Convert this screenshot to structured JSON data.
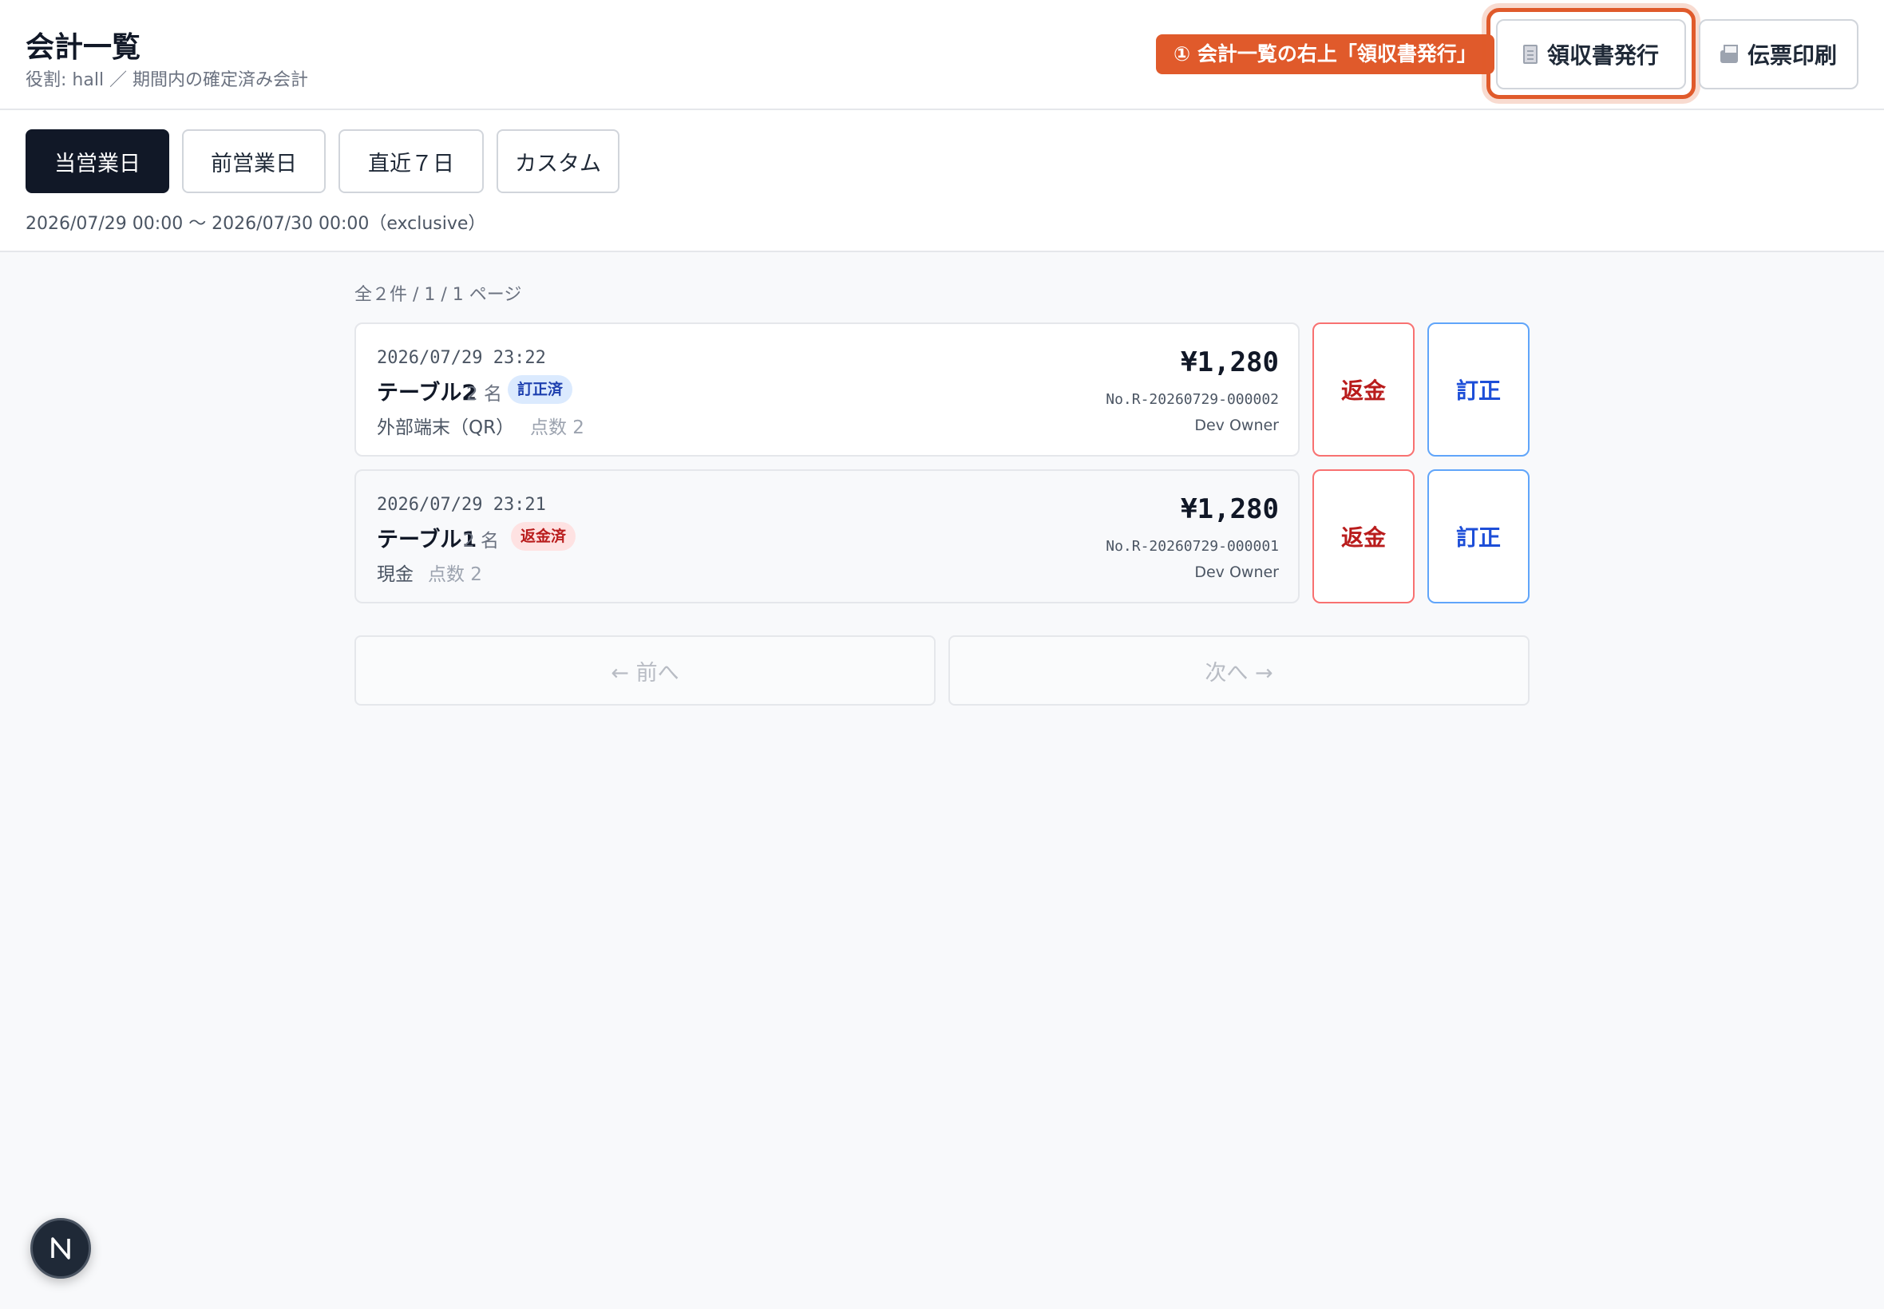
{
  "header": {
    "title": "会計一覧",
    "subtitle": "役割: hall ／ 期間内の確定済み会計",
    "callout": "① 会計一覧の右上「領収書発行」",
    "receipt_button": "領収書発行",
    "print_button": "伝票印刷",
    "receipt_icon": "receipt-icon",
    "print_icon": "printer-icon",
    "accent_color": "#e05a2b"
  },
  "filters": {
    "buttons": [
      "当営業日",
      "前営業日",
      "直近７日",
      "カスタム"
    ],
    "active": "当営業日",
    "range_text": "2026/07/29 00:00 〜 2026/07/30 00:00（exclusive）"
  },
  "list": {
    "count_text": "全２件 / 1 / 1 ページ",
    "rows": [
      {
        "datetime": "2026/07/29 23:22",
        "table": "テーブル2",
        "guests": "2 名",
        "badge": "訂正済",
        "payment": "外部端末（QR）",
        "points": "点数 2",
        "amount": "¥1,280",
        "receipt_no": "No.R-20260729-000002",
        "staff": "Dev Owner",
        "refund_label": "返金",
        "correct_label": "訂正"
      },
      {
        "datetime": "2026/07/29 23:21",
        "table": "テーブル1",
        "guests": "2 名",
        "badge": "返金済",
        "payment": "現金",
        "points": "点数 2",
        "amount": "¥1,280",
        "receipt_no": "No.R-20260729-000001",
        "staff": "Dev Owner",
        "refund_label": "返金",
        "correct_label": "訂正"
      }
    ]
  },
  "pagination": {
    "prev": "← 前へ",
    "next": "次へ →"
  },
  "dev_indicator": "N"
}
